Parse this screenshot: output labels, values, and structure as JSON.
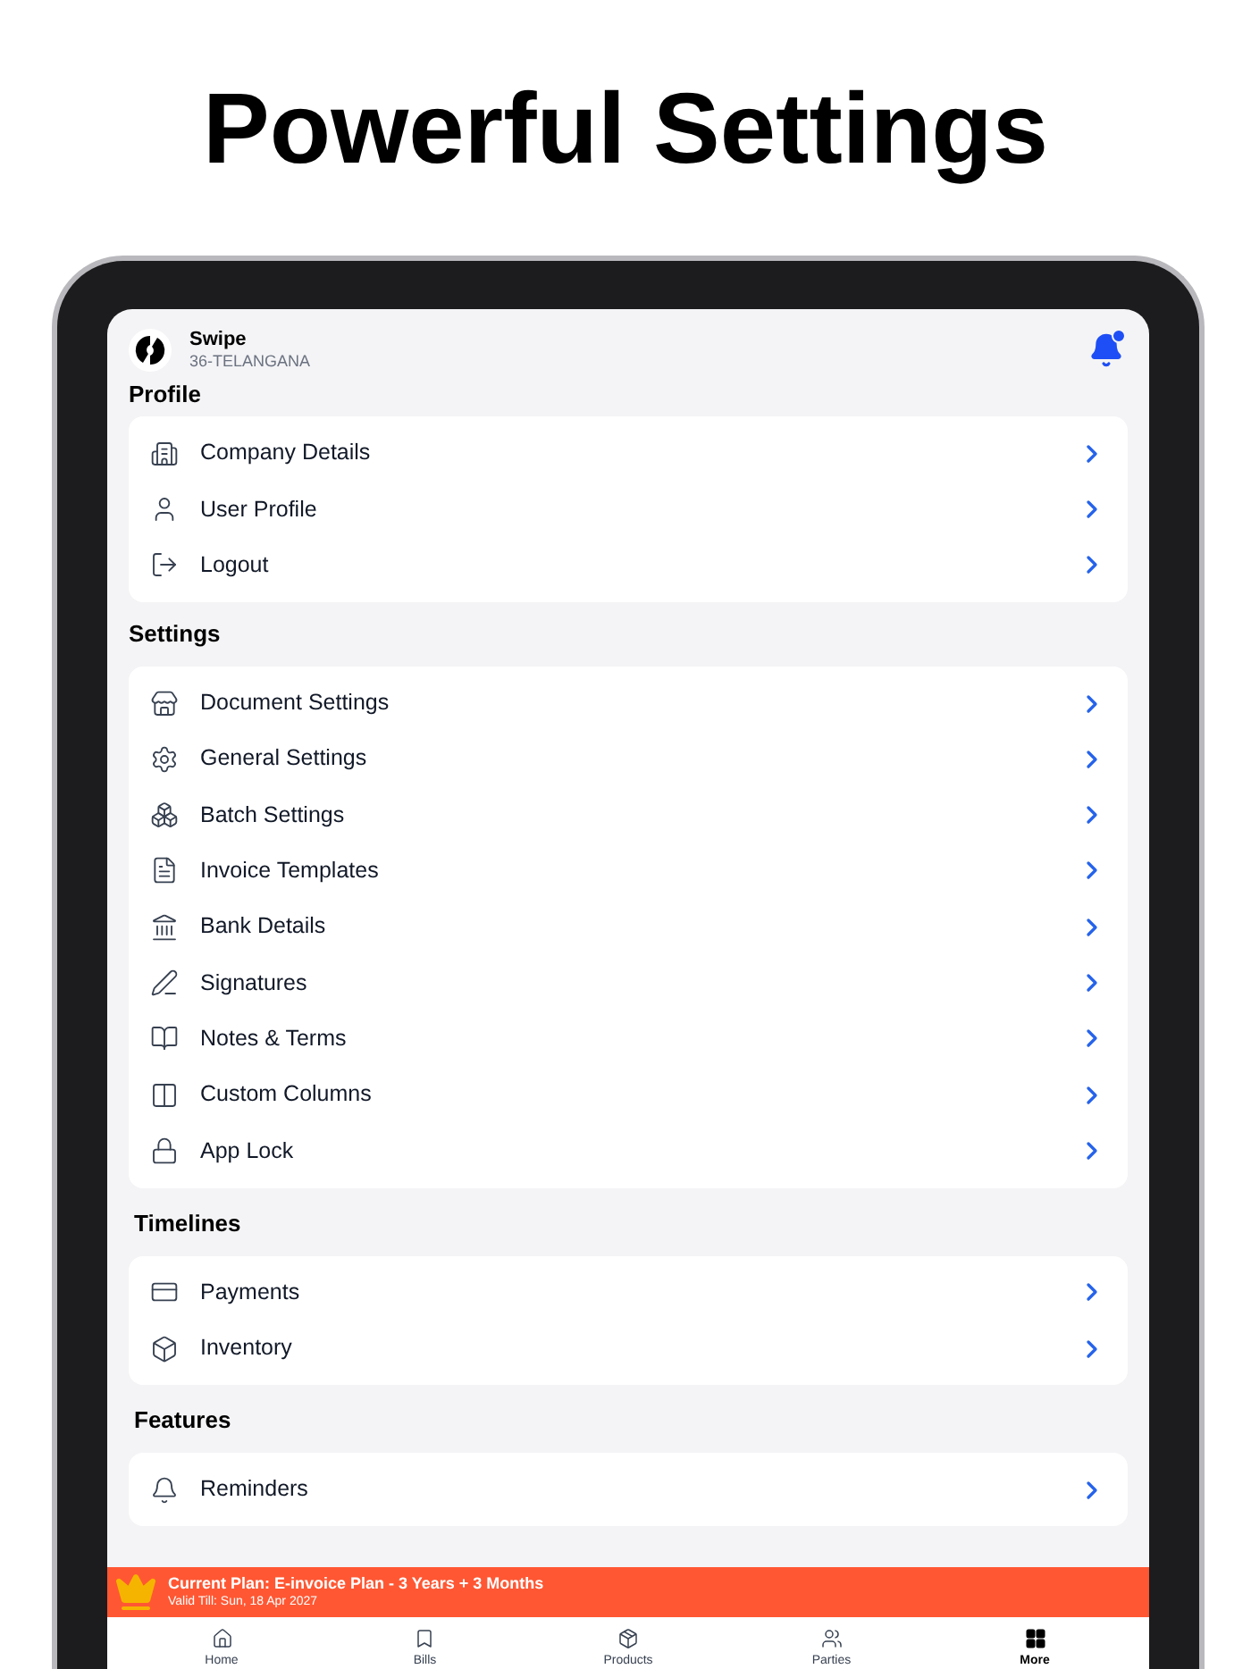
{
  "headline": "Powerful Settings",
  "header": {
    "company": "Swipe",
    "state": "36-TELANGANA",
    "notification_dot": true
  },
  "sections": [
    {
      "title": "Profile",
      "items": [
        {
          "label": "Company Details"
        },
        {
          "label": "User Profile"
        },
        {
          "label": "Logout"
        }
      ]
    },
    {
      "title": "Settings",
      "items": [
        {
          "label": "Document Settings"
        },
        {
          "label": "General Settings"
        },
        {
          "label": "Batch Settings"
        },
        {
          "label": "Invoice Templates"
        },
        {
          "label": "Bank Details"
        },
        {
          "label": "Signatures"
        },
        {
          "label": "Notes & Terms"
        },
        {
          "label": "Custom Columns"
        },
        {
          "label": "App Lock"
        }
      ]
    },
    {
      "title": "Timelines",
      "items": [
        {
          "label": "Payments"
        },
        {
          "label": "Inventory"
        }
      ]
    },
    {
      "title": "Features",
      "items": [
        {
          "label": "Reminders"
        }
      ]
    }
  ],
  "plan_banner": {
    "title": "Current Plan: E-invoice Plan - 3 Years + 3 Months",
    "subtitle": "Valid Till: Sun, 18 Apr 2027"
  },
  "tabs": [
    {
      "label": "Home",
      "selected": false
    },
    {
      "label": "Bills",
      "selected": false
    },
    {
      "label": "Products",
      "selected": false
    },
    {
      "label": "Parties",
      "selected": false
    },
    {
      "label": "More",
      "selected": true
    }
  ]
}
